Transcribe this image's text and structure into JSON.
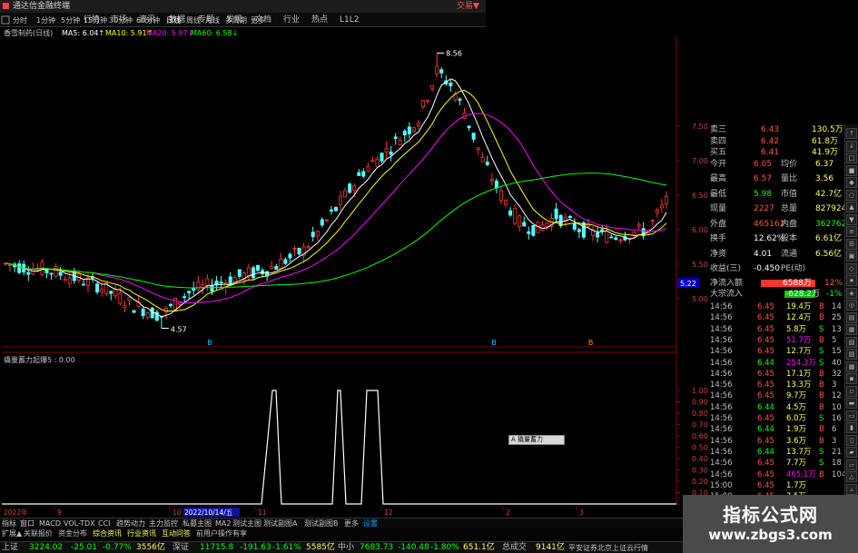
{
  "window": {
    "title": "通达信金融终端",
    "right_title": "交易▼"
  },
  "menu": [
    "行情",
    "市场",
    "资讯",
    "数据",
    "专题",
    "发现",
    "文档",
    "行业",
    "热点",
    "L1L2"
  ],
  "periods": {
    "items": [
      "分时",
      "1分钟",
      "5分钟",
      "15分钟",
      "30分钟",
      "60分钟",
      "日线",
      "周线",
      "月线",
      "多周期",
      "更多"
    ],
    "active_index": 6
  },
  "stock_line": {
    "name": "香雪制药(日线)",
    "ma5": "MA5: 6.04↑",
    "ma10": "MA10: 5.91↑",
    "ma20": "MA20: 5.97↓",
    "ma60": "MA60: 6.58↓"
  },
  "chart": {
    "price_ticks": [
      "7.50",
      "7.00",
      "6.50",
      "6.00",
      "5.50",
      "5.00"
    ],
    "current_price_tag": "5.22",
    "high_label": "8.56",
    "low_label": "4.57",
    "indicator_title": "撬量蓄力起爆5 : 0.00",
    "indicator_ticks": [
      "1.00",
      "0.90",
      "0.80",
      "0.70",
      "0.60",
      "0.50",
      "0.40",
      "0.30",
      "0.20",
      "0.10",
      "0.00"
    ],
    "date_axis": [
      "2022年",
      "9",
      "10",
      "2022/10/14/五",
      "11",
      "12",
      "2",
      "3"
    ],
    "signal_labels": [
      "B",
      "B",
      "B"
    ],
    "colors": {
      "up": "#ff3232",
      "down": "#54ffff",
      "ma5": "#ffffff",
      "ma10": "#ffff00",
      "ma20": "#ff00ff",
      "ma60": "#00ff00",
      "signal": "#ffffff"
    }
  },
  "popup": {
    "label": "A 撬量蓄力"
  },
  "quote": {
    "rows": [
      {
        "l": "卖三",
        "v": "6.43",
        "v2": "130.5万"
      },
      {
        "l": "卖四",
        "v": "6.42",
        "v2": "61.8万"
      },
      {
        "l": "买五",
        "v": "6.41",
        "v2": "41.9万"
      }
    ],
    "stats": [
      [
        "今开",
        "6.05",
        "均价",
        "6.37"
      ],
      [
        "最高",
        "6.57",
        "量比",
        "3.56"
      ],
      [
        "最低",
        "5.98",
        "市值",
        "42.7亿"
      ],
      [
        "现量",
        "2227",
        "总量",
        "827924"
      ],
      [
        "外盘",
        "465162",
        "内盘",
        "362762"
      ],
      [
        "换手",
        "12.62%",
        "股本",
        "6.61亿"
      ],
      [
        "净资",
        "4.01",
        "流通",
        "6.56亿"
      ],
      [
        "收益(三)",
        "-0.450",
        "PE(动)",
        ""
      ]
    ]
  },
  "flow": [
    {
      "label": "净流入额",
      "value": "6588万",
      "pct": "12%"
    },
    {
      "label": "大宗流入",
      "value": "-628.2万",
      "pct": "-1%"
    }
  ],
  "trades": [
    [
      "14:56",
      "6.45",
      "19.4万",
      "B",
      "14"
    ],
    [
      "14:56",
      "6.45",
      "12.4万",
      "B",
      "25"
    ],
    [
      "14:56",
      "6.45",
      "5.8万",
      "S",
      "13"
    ],
    [
      "14:56",
      "6.45",
      "51.7万",
      "B",
      "5"
    ],
    [
      "14:56",
      "6.45",
      "12.7万",
      "S",
      "15"
    ],
    [
      "14:56",
      "6.44",
      "254.3万",
      "S",
      "40"
    ],
    [
      "14:56",
      "6.45",
      "17.1万",
      "B",
      "32"
    ],
    [
      "14:56",
      "6.45",
      "13.3万",
      "B",
      "3"
    ],
    [
      "14:56",
      "6.45",
      "9.7万",
      "B",
      "12"
    ],
    [
      "14:56",
      "6.44",
      "4.5万",
      "B",
      "10"
    ],
    [
      "14:56",
      "6.45",
      "6.0万",
      "S",
      "16"
    ],
    [
      "14:56",
      "6.44",
      "1.9万",
      "B",
      "6"
    ],
    [
      "14:56",
      "6.45",
      "3.6万",
      "B",
      "3"
    ],
    [
      "14:56",
      "6.44",
      "13.7万",
      "S",
      "21"
    ],
    [
      "14:56",
      "6.45",
      "7.7万",
      "S",
      "18"
    ],
    [
      "14:56",
      "6.45",
      "465.1万",
      "B",
      "104"
    ],
    [
      "15:00",
      "6.45",
      "1.7万",
      "",
      ""
    ],
    [
      "15:00",
      "6.45",
      "7.5万",
      "",
      ""
    ]
  ],
  "right_tools": [
    "↑",
    "↓",
    "□",
    "■",
    "◆",
    "○",
    "▲",
    "▼",
    "≡",
    "☰",
    "▣",
    "◇",
    "★",
    "◈",
    "◎",
    "▤",
    "▦",
    "▧",
    "▨",
    "▩",
    "▪",
    "▫",
    "▬",
    "▭",
    "▮",
    "▯",
    "▰",
    "▱",
    "△",
    "▵",
    "▷",
    "▹",
    "▻"
  ],
  "tabs": [
    "指标",
    "窗口",
    "MACD",
    "VOL-TDX",
    "CCI",
    "趋势动力",
    "主力监控",
    "私募主图",
    "MA2",
    "测试主图",
    "测试副图A",
    "测试副图B",
    "更多",
    "设置"
  ],
  "tabs2": [
    "扩展▲",
    "关联报价",
    "资金分布",
    "综合资讯",
    "行业资讯",
    "互动问答",
    "前用户操作有享"
  ],
  "status": [
    {
      "name": "上证",
      "val": "3224.02",
      "chg": "-25.01",
      "pct": "-0.77%",
      "amt": "3556亿"
    },
    {
      "name": "深证",
      "val": "11715.8",
      "chg": "-191.63",
      "pct": "-1.61%",
      "amt": "5585亿"
    },
    {
      "name": "中小",
      "val": "7683.73",
      "chg": "-140.48",
      "pct": "-1.80%",
      "amt": "651.1亿"
    }
  ],
  "status_extra": {
    "label": "总成交",
    "value": "9141亿",
    "broker": "平安证券北京上证云行情"
  },
  "watermark": {
    "line1": "指标公式网",
    "line2": "www.zbgs3.com"
  }
}
